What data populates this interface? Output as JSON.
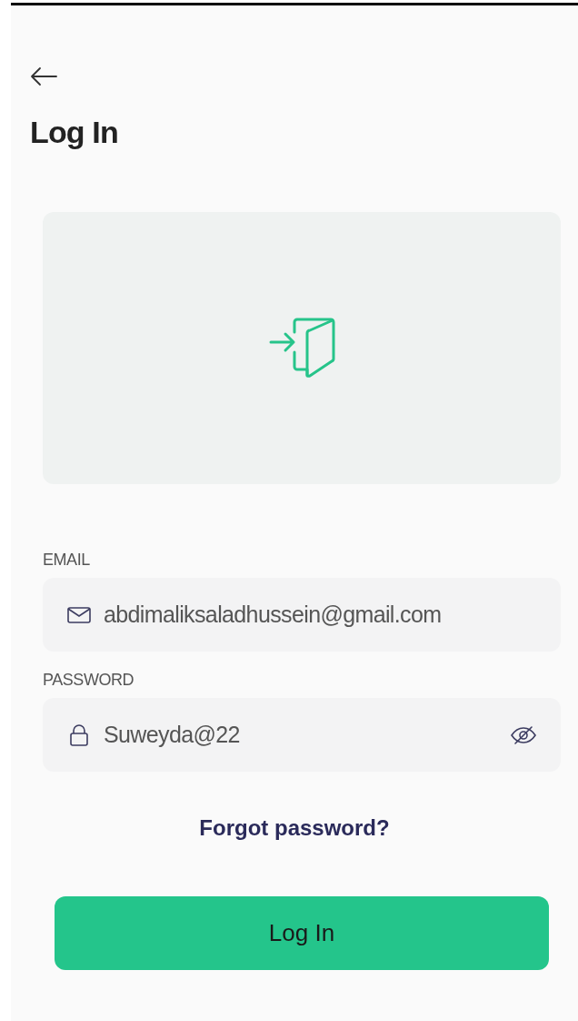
{
  "title": "Log In",
  "fields": [
    {
      "kind": "email",
      "label": "EMAIL",
      "value": "abdimaliksaladhussein@gmail.com"
    },
    {
      "kind": "password",
      "label": "PASSWORD",
      "value": "Suweyda@22"
    }
  ],
  "forgot_link": "Forgot password?",
  "submit_button": "Log In"
}
